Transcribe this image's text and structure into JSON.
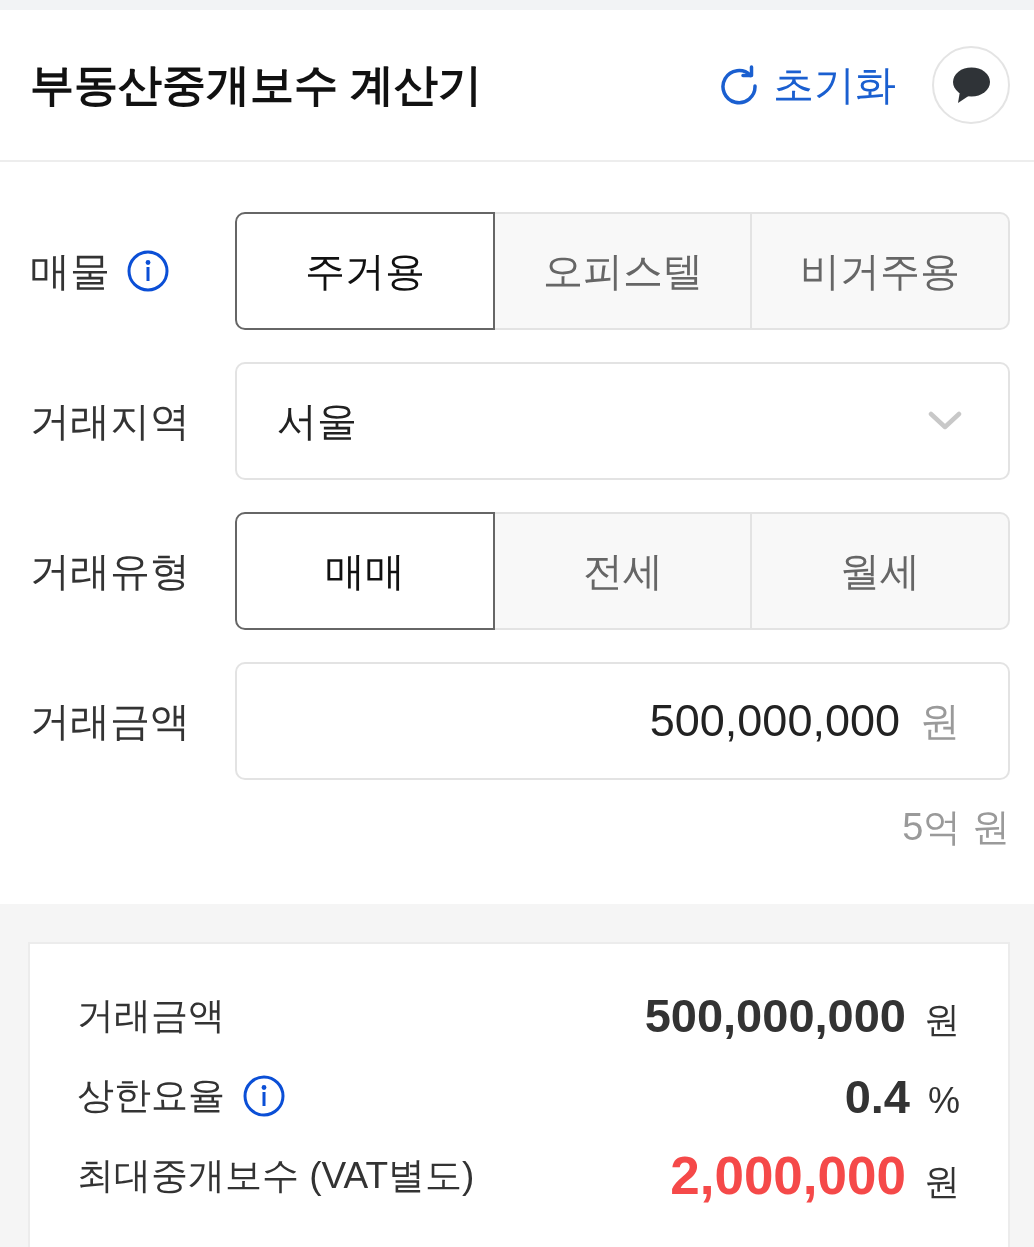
{
  "header": {
    "title": "부동산중개보수 계산기",
    "reset_button": "초기화"
  },
  "form": {
    "fields": [
      {
        "kind": "segmented",
        "label": "매물",
        "info_icon": true,
        "options": [
          {
            "label": "주거용",
            "selected": true
          },
          {
            "label": "오피스텔",
            "selected": false
          },
          {
            "label": "비거주용",
            "selected": false
          }
        ]
      },
      {
        "kind": "select",
        "label": "거래지역",
        "info_icon": false,
        "value": "서울"
      },
      {
        "kind": "segmented",
        "label": "거래유형",
        "info_icon": false,
        "options": [
          {
            "label": "매매",
            "selected": true
          },
          {
            "label": "전세",
            "selected": false
          },
          {
            "label": "월세",
            "selected": false
          }
        ]
      },
      {
        "kind": "amount",
        "label": "거래금액",
        "info_icon": false,
        "value": "500,000,000",
        "unit": "원",
        "hint": "5억 원"
      }
    ]
  },
  "result": {
    "rows": [
      {
        "label": "거래금액",
        "info_icon": false,
        "value": "500,000,000",
        "unit": "원",
        "highlight": false
      },
      {
        "label": "상한요율",
        "info_icon": true,
        "value": "0.4",
        "unit": "%",
        "highlight": false
      },
      {
        "label": "최대중개보수 (VAT별도)",
        "info_icon": false,
        "value": "2,000,000",
        "unit": "원",
        "highlight": true
      }
    ]
  }
}
